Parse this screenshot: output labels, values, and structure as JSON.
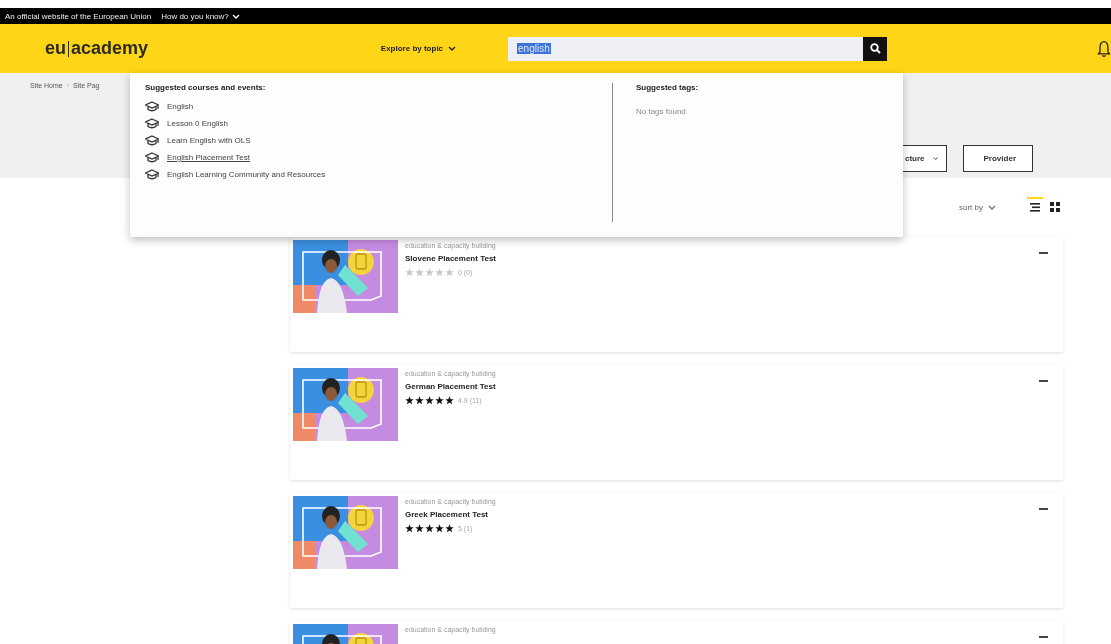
{
  "top_bar": {
    "text": "An official website of the European Union",
    "link": "How do you know?"
  },
  "header": {
    "logo_left": "eu",
    "logo_right": "academy",
    "explore": "Explore by topic",
    "search": {
      "value": "english"
    }
  },
  "breadcrumb": [
    "Site Home",
    "Site Pag"
  ],
  "breadcrumb_separator": "›",
  "filters": [
    "cture",
    "Provider"
  ],
  "sort": {
    "label": "sort by"
  },
  "view_toggle": [
    {
      "kind": "list",
      "selected": true
    },
    {
      "kind": "grid",
      "selected": false
    }
  ],
  "suggestions": {
    "courses_title": "Suggested courses and events:",
    "courses": [
      {
        "label": "English",
        "hovered": false
      },
      {
        "label": "Lesson 0 English",
        "hovered": false
      },
      {
        "label": "Learn English with OLS",
        "hovered": false
      },
      {
        "label": "English Placement Test",
        "hovered": true
      },
      {
        "label": "English Learning Community and Resources",
        "hovered": false
      }
    ],
    "tags_title": "Suggested tags:",
    "tags_empty": "No tags found"
  },
  "courses": [
    {
      "category": "education & capacity building",
      "title": "Slovene Placement Test",
      "stars": 0,
      "rating": "0 (0)"
    },
    {
      "category": "education & capacity building",
      "title": "German Placement Test",
      "stars": 5,
      "rating": "4.9 (11)"
    },
    {
      "category": "education & capacity building",
      "title": "Greek Placement Test",
      "stars": 5,
      "rating": "5 (1)"
    },
    {
      "category": "education & capacity building"
    }
  ]
}
